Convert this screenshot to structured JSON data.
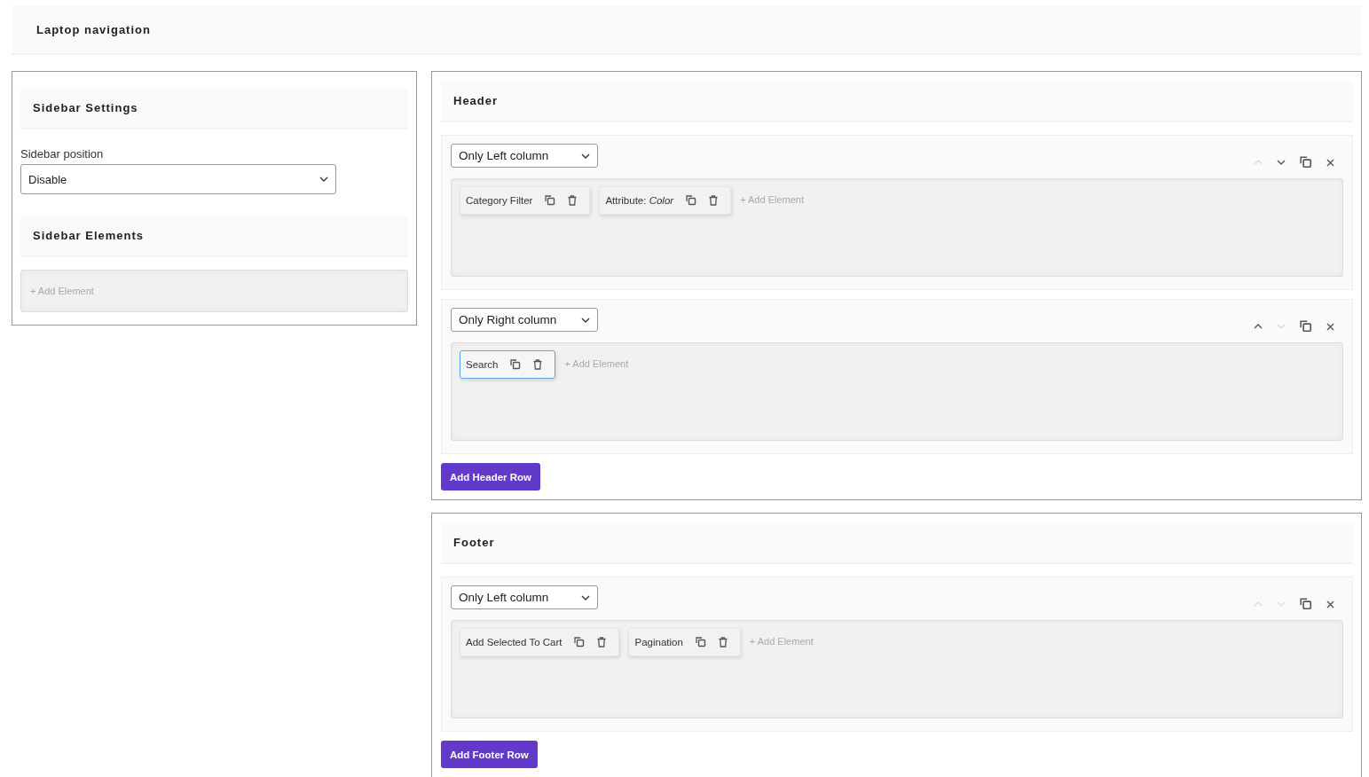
{
  "page_title": "Laptop navigation",
  "sidebar": {
    "settings_title": "Sidebar Settings",
    "position_label": "Sidebar position",
    "position_value": "Disable",
    "elements_title": "Sidebar Elements",
    "add_element": "+ Add Element"
  },
  "sections": [
    {
      "title": "Header",
      "add_row_button": "Add Header Row",
      "rows": [
        {
          "layout": "Only Left column",
          "up_disabled": true,
          "down_disabled": false,
          "add_element": "+ Add Element",
          "elements": [
            {
              "label": "Category Filter",
              "selected": false
            },
            {
              "label": "Attribute: *Color*",
              "selected": false
            }
          ]
        },
        {
          "layout": "Only Right column",
          "up_disabled": false,
          "down_disabled": true,
          "add_element": "+ Add Element",
          "elements": [
            {
              "label": "Search",
              "selected": true
            }
          ]
        }
      ]
    },
    {
      "title": "Footer",
      "add_row_button": "Add Footer Row",
      "rows": [
        {
          "layout": "Only Left column",
          "up_disabled": true,
          "down_disabled": true,
          "add_element": "+ Add Element",
          "elements": [
            {
              "label": "Add Selected To Cart",
              "selected": false
            },
            {
              "label": "Pagination",
              "selected": false
            }
          ]
        }
      ]
    }
  ]
}
